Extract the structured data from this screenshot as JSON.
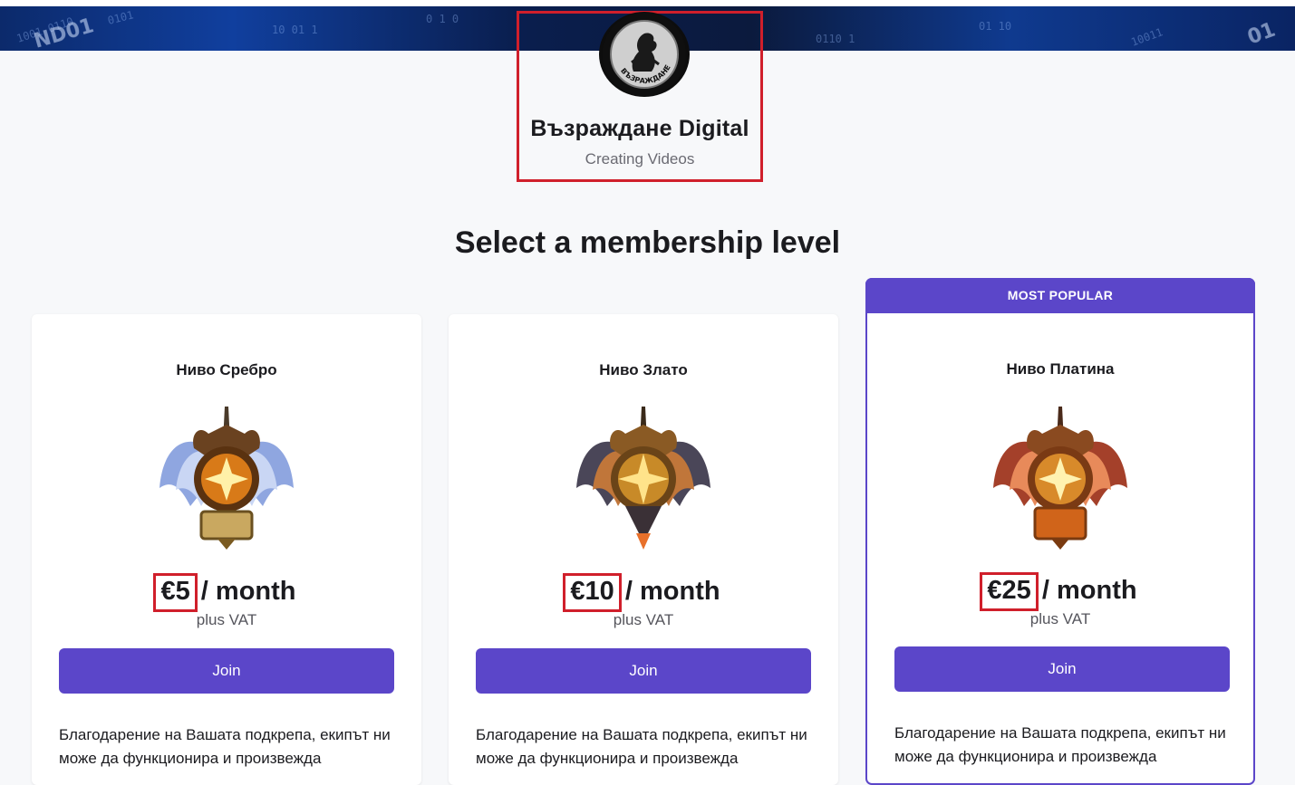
{
  "creator": {
    "name": "Възраждане Digital",
    "subtitle": "Creating Videos",
    "logo_text": "ВЪЗРАЖДАНЕ"
  },
  "page_title": "Select a membership level",
  "tiers": [
    {
      "name": "Ниво Сребро",
      "price": "€5",
      "period": " / month",
      "vat": "plus VAT",
      "join_label": "Join",
      "description": "Благодарение на Вашата подкрепа, екипът ни може да функционира и произвежда",
      "badge_icon": "silver-rank-emblem-icon",
      "wing_color": "#8fa6e0"
    },
    {
      "name": "Ниво Злато",
      "price": "€10",
      "period": " / month",
      "vat": "plus VAT",
      "join_label": "Join",
      "description": "Благодарение на Вашата подкрепа, екипът ни може да функционира и произвежда",
      "badge_icon": "gold-rank-emblem-icon",
      "wing_color": "#4a4658"
    },
    {
      "name": "Ниво Платина",
      "price": "€25",
      "period": " / month",
      "vat": "plus VAT",
      "join_label": "Join",
      "description": "Благодарение на Вашата подкрепа, екипът ни може да функционира и произвежда",
      "badge_icon": "platinum-rank-emblem-icon",
      "wing_color": "#a4402a",
      "badge": "MOST POPULAR"
    }
  ],
  "colors": {
    "accent": "#5b46c9",
    "highlight_box": "#d01f2b",
    "background": "#f7f8fa"
  }
}
